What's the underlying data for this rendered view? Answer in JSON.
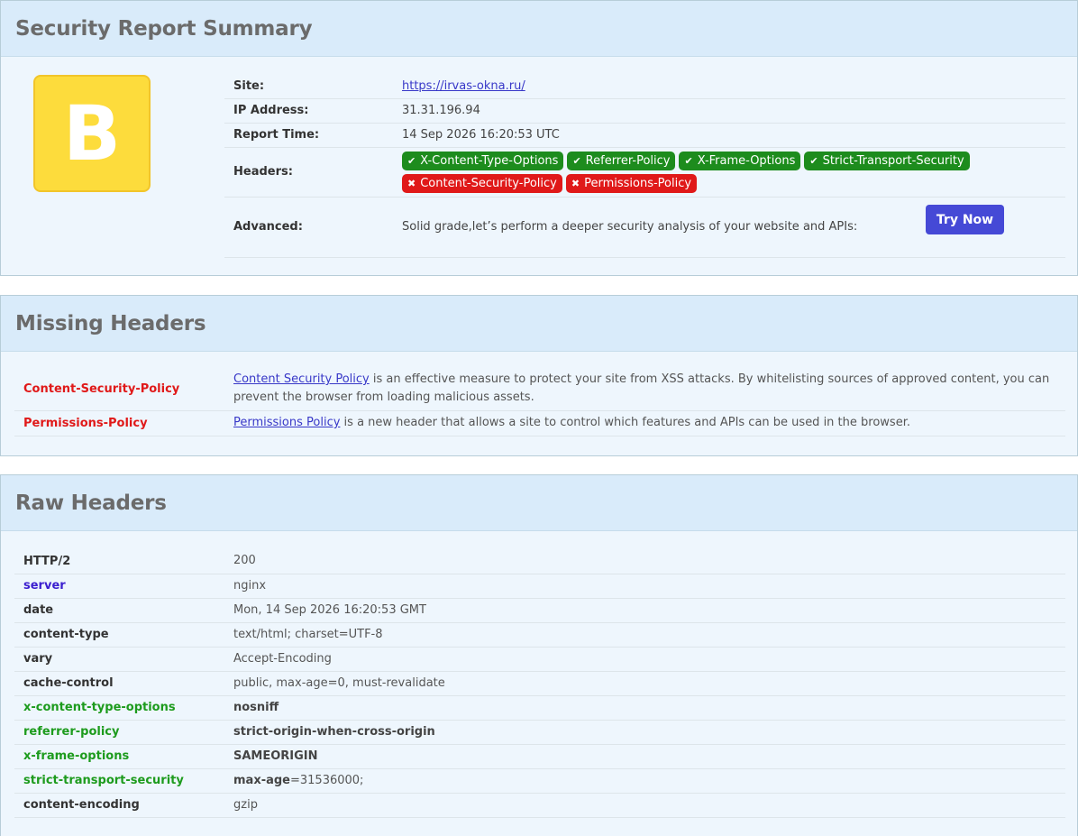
{
  "summary": {
    "title": "Security Report Summary",
    "grade": "B",
    "site_label": "Site:",
    "site_value": "https://irvas-okna.ru/",
    "ip_label": "IP Address:",
    "ip_value": "31.31.196.94",
    "time_label": "Report Time:",
    "time_value": "14 Sep 2026 16:20:53 UTC",
    "headers_label": "Headers:",
    "present_headers": [
      "X-Content-Type-Options",
      "Referrer-Policy",
      "X-Frame-Options",
      "Strict-Transport-Security"
    ],
    "missing_headers": [
      "Content-Security-Policy",
      "Permissions-Policy"
    ],
    "advanced_label": "Advanced:",
    "advanced_text": "Solid grade,let’s perform a deeper security analysis of your website and APIs:",
    "try_button": "Try Now"
  },
  "missing": {
    "title": "Missing Headers",
    "rows": [
      {
        "name": "Content-Security-Policy",
        "link": "Content Security Policy",
        "text": " is an effective measure to protect your site from XSS attacks. By whitelisting sources of approved content, you can prevent the browser from loading malicious assets."
      },
      {
        "name": "Permissions-Policy",
        "link": "Permissions Policy",
        "text": " is a new header that allows a site to control which features and APIs can be used in the browser."
      }
    ]
  },
  "raw": {
    "title": "Raw Headers",
    "rows": [
      {
        "name": "HTTP/2",
        "value": "200"
      },
      {
        "name": "server",
        "value": "nginx"
      },
      {
        "name": "date",
        "value": "Mon, 14 Sep 2026 16:20:53 GMT"
      },
      {
        "name": "content-type",
        "value": "text/html; charset=UTF-8"
      },
      {
        "name": "vary",
        "value": "Accept-Encoding"
      },
      {
        "name": "cache-control",
        "value": "public, max-age=0, must-revalidate"
      },
      {
        "name": "x-content-type-options",
        "value": "nosniff"
      },
      {
        "name": "referrer-policy",
        "value": "strict-origin-when-cross-origin"
      },
      {
        "name": "x-frame-options",
        "value": "SAMEORIGIN"
      },
      {
        "name": "strict-transport-security",
        "value_key": "max-age",
        "value": "=31536000;"
      },
      {
        "name": "content-encoding",
        "value": "gzip"
      }
    ]
  },
  "colors": {
    "grade_bg": "#fddc3c",
    "ok_badge": "#1d8c1d",
    "bad_badge": "#e01919",
    "button": "#4549d6",
    "header_blue": "#3b1fcf",
    "header_green": "#1d9b1d"
  },
  "icons": {
    "present": "check-icon",
    "missing": "cross-icon"
  }
}
